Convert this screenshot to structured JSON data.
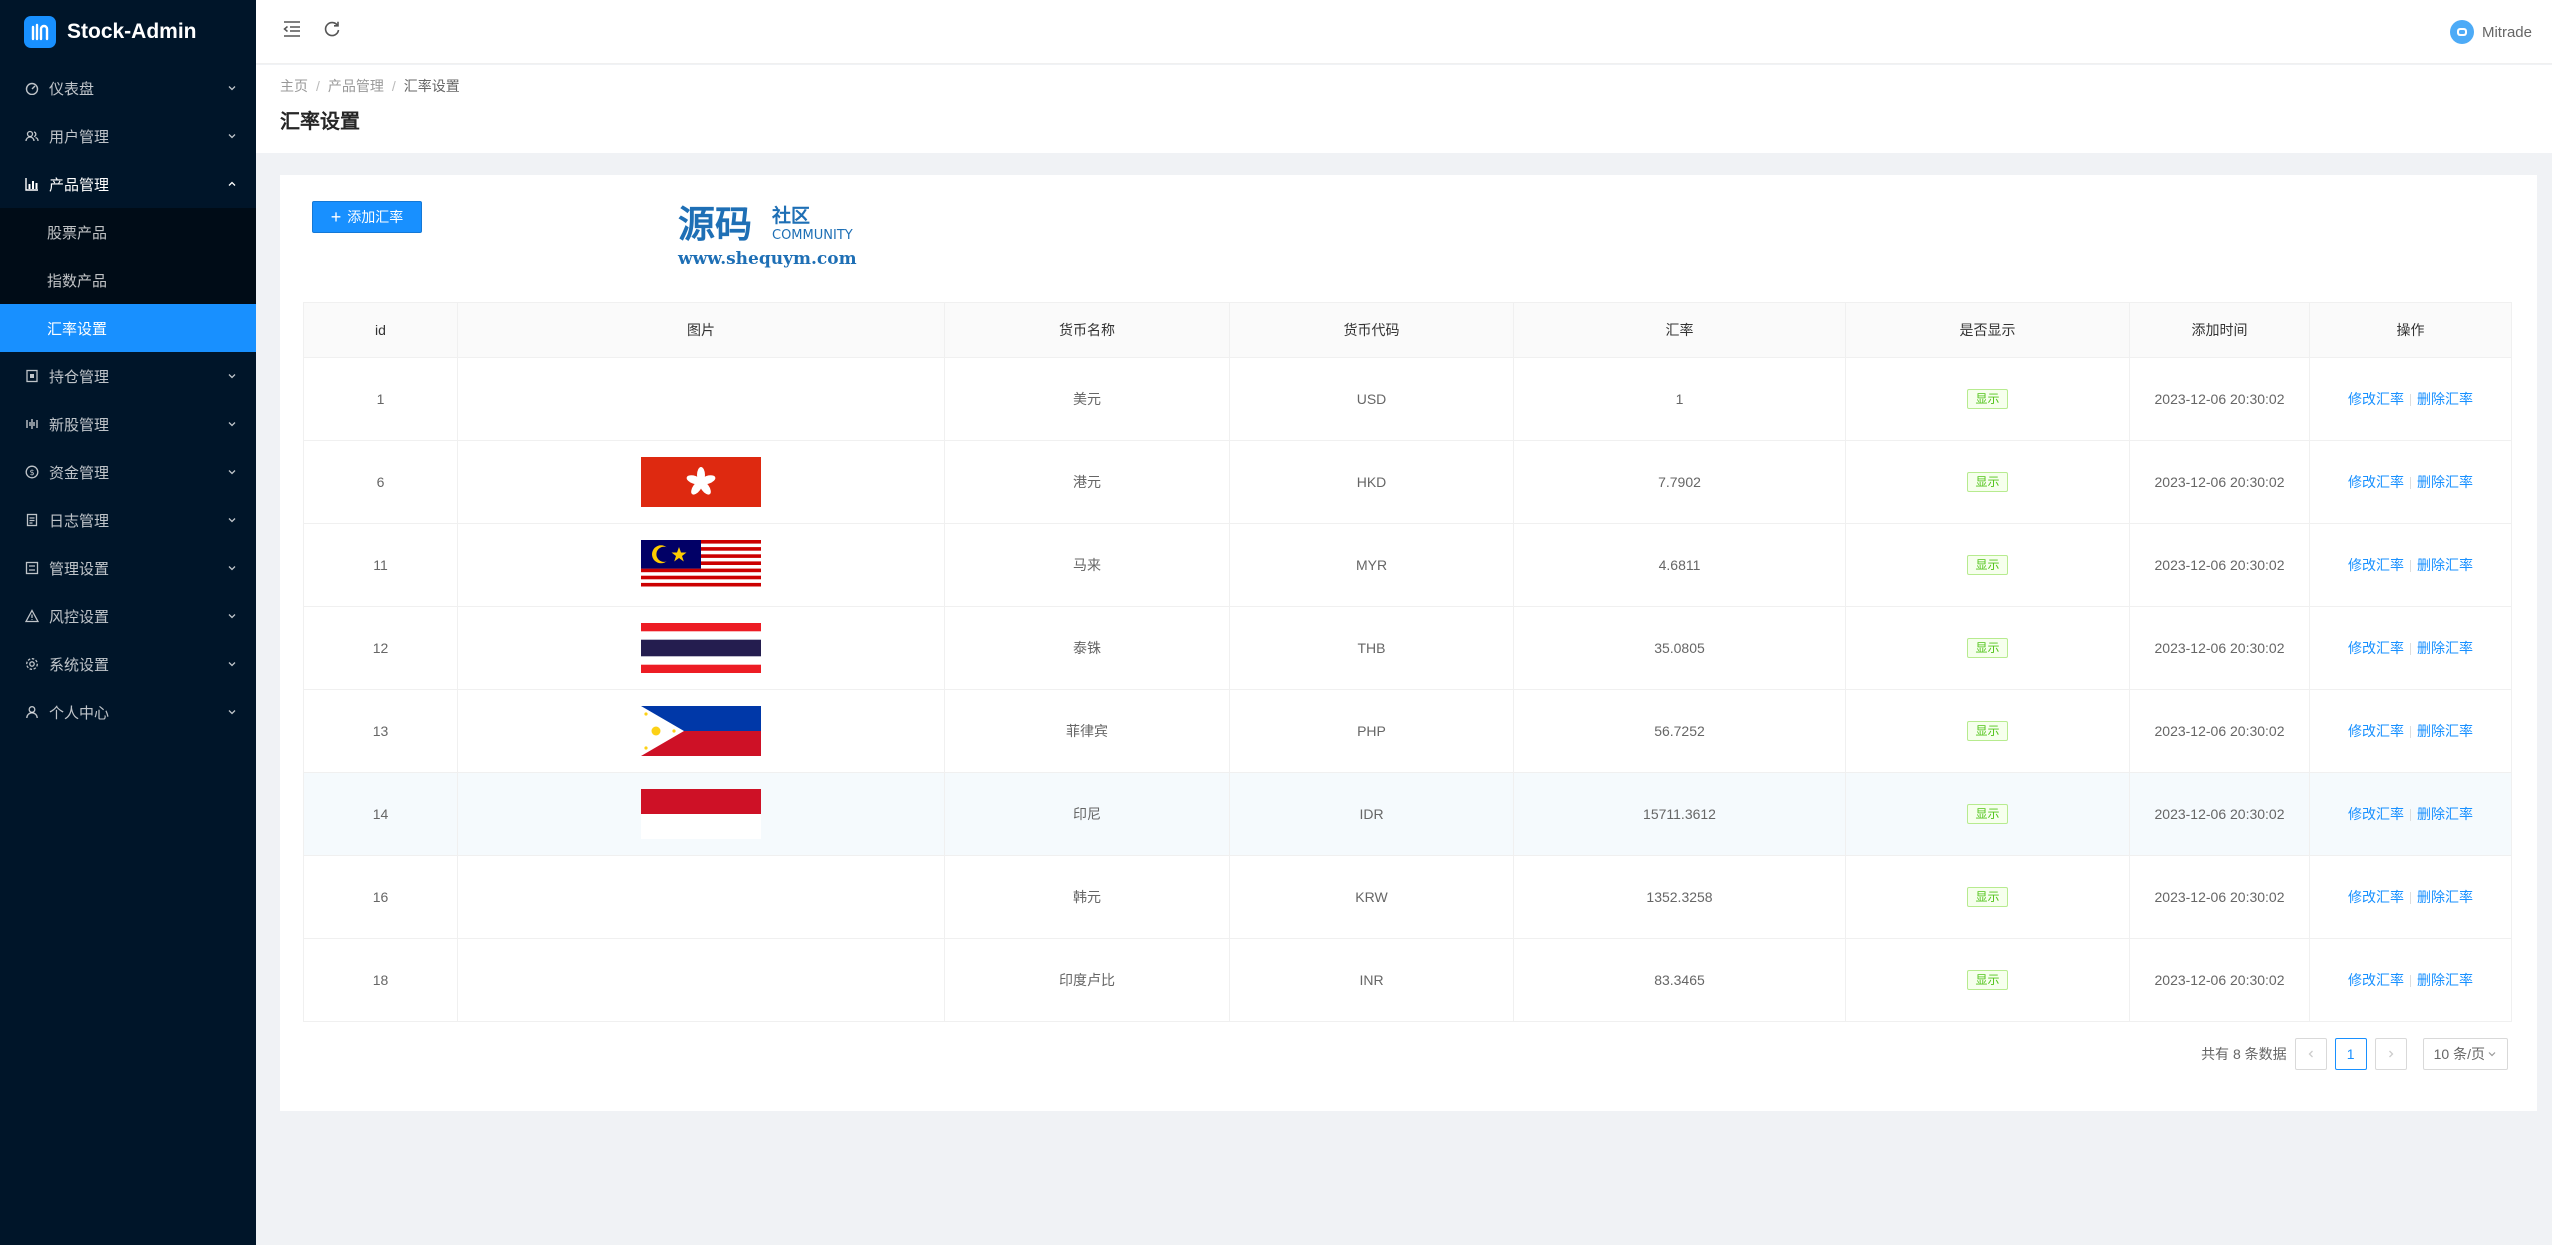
{
  "app": {
    "name": "Stock-Admin"
  },
  "sidebar": {
    "items": [
      {
        "label": "仪表盘",
        "icon": "dashboard-icon"
      },
      {
        "label": "用户管理",
        "icon": "users-icon"
      },
      {
        "label": "产品管理",
        "icon": "chart-icon",
        "open": true,
        "children": [
          {
            "label": "股票产品"
          },
          {
            "label": "指数产品"
          },
          {
            "label": "汇率设置",
            "active": true
          }
        ]
      },
      {
        "label": "持仓管理",
        "icon": "position-icon"
      },
      {
        "label": "新股管理",
        "icon": "ipo-icon"
      },
      {
        "label": "资金管理",
        "icon": "money-icon"
      },
      {
        "label": "日志管理",
        "icon": "log-icon"
      },
      {
        "label": "管理设置",
        "icon": "admin-settings-icon"
      },
      {
        "label": "风控设置",
        "icon": "warning-icon"
      },
      {
        "label": "系统设置",
        "icon": "gear-icon"
      },
      {
        "label": "个人中心",
        "icon": "user-icon"
      }
    ]
  },
  "header": {
    "user": "Mitrade"
  },
  "breadcrumb": [
    "主页",
    "产品管理",
    "汇率设置"
  ],
  "page": {
    "title": "汇率设置",
    "add_button": "添加汇率"
  },
  "watermark": {
    "cn": "源码",
    "cn2": "社区",
    "en": "COMMUNITY",
    "url": "www.shequym.com"
  },
  "table": {
    "columns": [
      "id",
      "图片",
      "货币名称",
      "货币代码",
      "汇率",
      "是否显示",
      "添加时间",
      "操作"
    ],
    "rows": [
      {
        "id": "1",
        "flag": "",
        "name": "美元",
        "code": "USD",
        "rate": "1",
        "show": "显示",
        "time": "2023-12-06 20:30:02"
      },
      {
        "id": "6",
        "flag": "hk",
        "name": "港元",
        "code": "HKD",
        "rate": "7.7902",
        "show": "显示",
        "time": "2023-12-06 20:30:02"
      },
      {
        "id": "11",
        "flag": "my",
        "name": "马来",
        "code": "MYR",
        "rate": "4.6811",
        "show": "显示",
        "time": "2023-12-06 20:30:02"
      },
      {
        "id": "12",
        "flag": "th",
        "name": "泰铢",
        "code": "THB",
        "rate": "35.0805",
        "show": "显示",
        "time": "2023-12-06 20:30:02"
      },
      {
        "id": "13",
        "flag": "ph",
        "name": "菲律宾",
        "code": "PHP",
        "rate": "56.7252",
        "show": "显示",
        "time": "2023-12-06 20:30:02"
      },
      {
        "id": "14",
        "flag": "id",
        "name": "印尼",
        "code": "IDR",
        "rate": "15711.3612",
        "show": "显示",
        "time": "2023-12-06 20:30:02"
      },
      {
        "id": "16",
        "flag": "",
        "name": "韩元",
        "code": "KRW",
        "rate": "1352.3258",
        "show": "显示",
        "time": "2023-12-06 20:30:02"
      },
      {
        "id": "18",
        "flag": "",
        "name": "印度卢比",
        "code": "INR",
        "rate": "83.3465",
        "show": "显示",
        "time": "2023-12-06 20:30:02"
      }
    ],
    "actions": {
      "edit": "修改汇率",
      "delete": "删除汇率"
    }
  },
  "pagination": {
    "total_text": "共有 8 条数据",
    "current": "1",
    "page_size": "10 条/页"
  },
  "colors": {
    "primary": "#1890ff",
    "sidebar_bg": "#001529",
    "submenu_bg": "#000c17",
    "tag_green": "#52c41a"
  }
}
